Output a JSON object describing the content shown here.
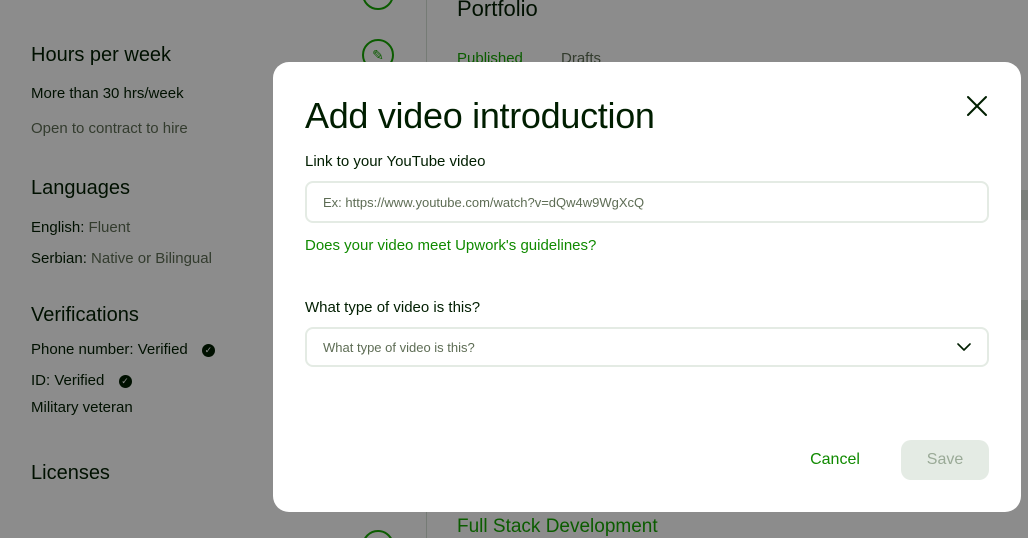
{
  "background": {
    "sidebar": {
      "hours_title": "Hours per week",
      "hours_value": "More than 30 hrs/week",
      "contract_to_hire": "Open to contract to hire",
      "languages_title": "Languages",
      "languages": [
        {
          "name": "English:",
          "level": "Fluent"
        },
        {
          "name": "Serbian:",
          "level": "Native or Bilingual"
        }
      ],
      "verifications_title": "Verifications",
      "phone": "Phone number: Verified",
      "id": "ID: Verified",
      "military": "Military veteran",
      "licenses_title": "Licenses"
    },
    "main": {
      "portfolio_title": "Portfolio",
      "tabs": [
        "Published",
        "Drafts"
      ],
      "project_title": "Full Stack Development"
    }
  },
  "modal": {
    "title": "Add video introduction",
    "link_label": "Link to your YouTube video",
    "link_placeholder": "Ex: https://www.youtube.com/watch?v=dQw4w9WgXcQ",
    "guidelines_link": "Does your video meet Upwork's guidelines?",
    "type_label": "What type of video is this?",
    "type_placeholder": "What type of video is this?",
    "cancel_label": "Cancel",
    "save_label": "Save"
  },
  "colors": {
    "accent": "#14a800",
    "link": "#108a00",
    "overlay": "rgba(0,0,0,0.45)"
  }
}
